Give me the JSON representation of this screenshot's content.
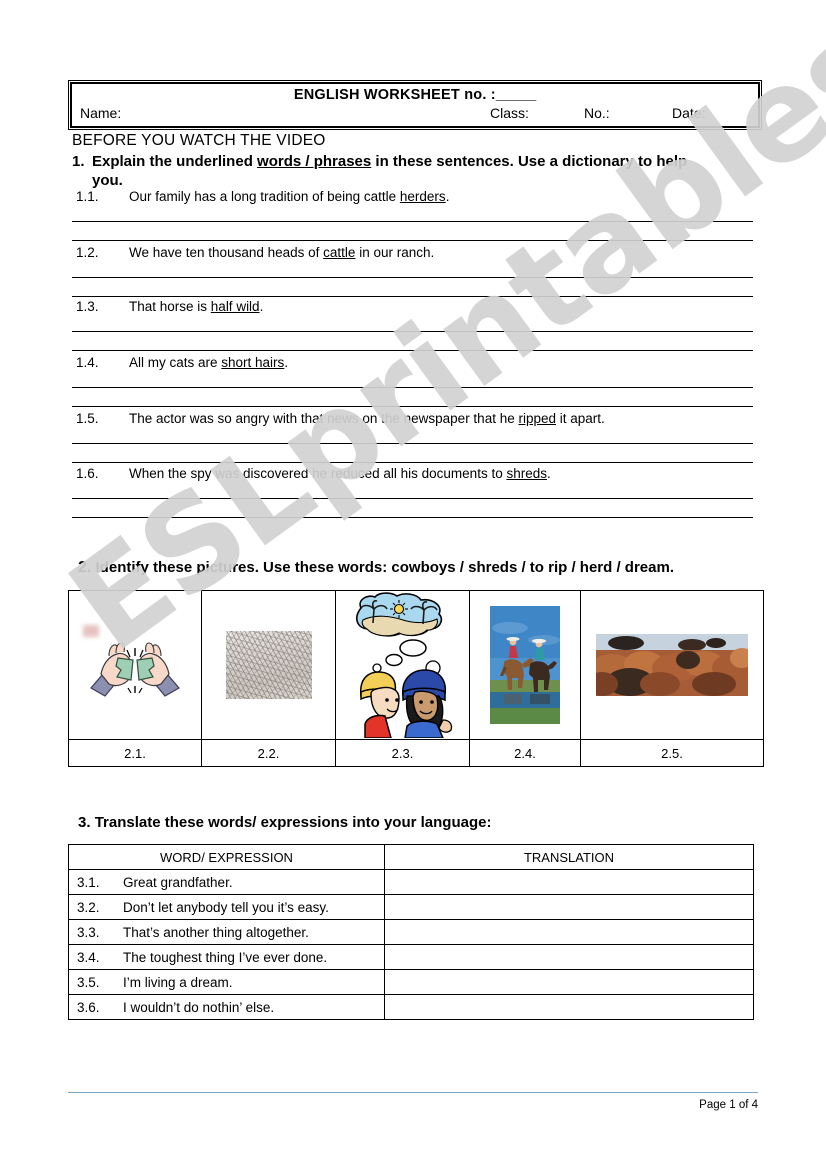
{
  "header": {
    "title": "ENGLISH WORKSHEET no. :",
    "title_blank": "_____",
    "name_label": "Name:",
    "class_label": "Class:",
    "no_label": "No.:",
    "date_label": "Date:"
  },
  "before_video_heading": "BEFORE YOU WATCH THE VIDEO",
  "section1": {
    "number": "1.",
    "instruction_part1": "Explain the underlined ",
    "instruction_underlined": "words / phrases",
    "instruction_part2": " in these sentences. Use a dictionary to help",
    "instruction_line2": "you.",
    "items": [
      {
        "num": "1.1.",
        "pre": "Our family has a long tradition of being cattle ",
        "underlined": "herders",
        "post": "."
      },
      {
        "num": "1.2.",
        "pre": "We have ten thousand heads of ",
        "underlined": "cattle",
        "post": " in our ranch."
      },
      {
        "num": "1.3.",
        "pre": "That horse is ",
        "underlined": "half wild",
        "post": "."
      },
      {
        "num": "1.4.",
        "pre": "All my cats are ",
        "underlined": "short hairs",
        "post": "."
      },
      {
        "num": "1.5.",
        "pre": "The actor was so angry with that news on the newspaper that he ",
        "underlined": "ripped",
        "post": " it apart."
      },
      {
        "num": "1.6.",
        "pre": "When the spy was discovered he reduced all his documents to ",
        "underlined": "shreds",
        "post": "."
      }
    ]
  },
  "section2": {
    "number": "2.",
    "instruction": "Identify these pictures. Use these words: cowboys / shreds / to rip / herd / dream.",
    "cells": [
      {
        "label": "2.1.",
        "icon": "hands-ripping-banknote-image"
      },
      {
        "label": "2.2.",
        "icon": "paper-shreds-photo"
      },
      {
        "label": "2.3.",
        "icon": "kids-dreaming-of-beach-image"
      },
      {
        "label": "2.4.",
        "icon": "cowboys-on-horseback-photo"
      },
      {
        "label": "2.5.",
        "icon": "cattle-herd-photo"
      }
    ]
  },
  "section3": {
    "number": "3.",
    "instruction": "Translate these words/ expressions into your language:",
    "columns": [
      "WORD/ EXPRESSION",
      "TRANSLATION"
    ],
    "rows": [
      {
        "num": "3.1.",
        "expression": "Great grandfather.",
        "translation": ""
      },
      {
        "num": "3.2.",
        "expression": "Don’t let anybody tell you it’s easy.",
        "translation": ""
      },
      {
        "num": "3.3.",
        "expression": "That’s another thing altogether.",
        "translation": ""
      },
      {
        "num": "3.4.",
        "expression": "The toughest thing I’ve ever done.",
        "translation": ""
      },
      {
        "num": "3.5.",
        "expression": "I’m living a dream.",
        "translation": ""
      },
      {
        "num": "3.6.",
        "expression": "I wouldn’t do nothin’ else.",
        "translation": ""
      }
    ]
  },
  "footer": {
    "page_text": "Page 1 of 4"
  },
  "watermark": {
    "text": "ESLprintables.com",
    "color": "#d2d2d2"
  }
}
